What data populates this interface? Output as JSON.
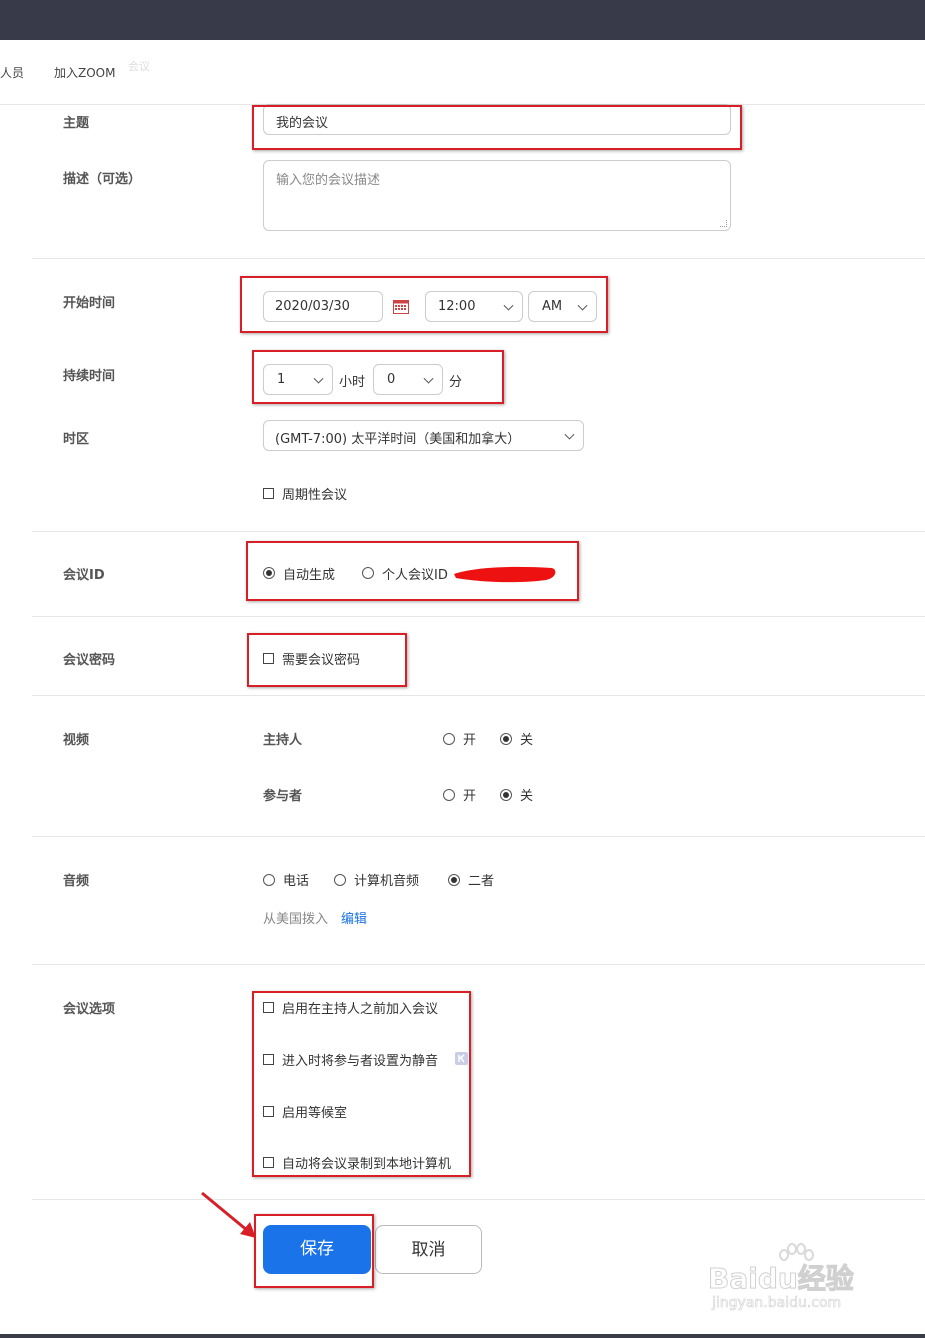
{
  "nav": {
    "item1": "人员",
    "item2": "加入ZOOM",
    "faint": "会议"
  },
  "labels": {
    "topic": "主题",
    "description": "描述（可选）",
    "start_time": "开始时间",
    "duration": "持续时间",
    "timezone": "时区",
    "meeting_id": "会议ID",
    "password": "会议密码",
    "video": "视频",
    "audio": "音频",
    "options": "会议选项"
  },
  "topic": {
    "value": "我的会议"
  },
  "description": {
    "placeholder": "输入您的会议描述"
  },
  "start": {
    "date": "2020/03/30",
    "time": "12:00",
    "ampm": "AM"
  },
  "duration": {
    "hours": "1",
    "hours_unit": "小时",
    "minutes": "0",
    "minutes_unit": "分"
  },
  "timezone": {
    "value": "(GMT-7:00) 太平洋时间（美国和加拿大）"
  },
  "recurring": {
    "label": "周期性会议",
    "checked": false
  },
  "meeting_id": {
    "auto_label": "自动生成",
    "personal_label": "个人会议ID",
    "selected": "auto"
  },
  "password": {
    "label": "需要会议密码",
    "checked": false
  },
  "video": {
    "host_label": "主持人",
    "participant_label": "参与者",
    "on_label": "开",
    "off_label": "关",
    "host": "off",
    "participant": "off"
  },
  "audio": {
    "phone_label": "电话",
    "computer_label": "计算机音频",
    "both_label": "二者",
    "selected": "both",
    "dial_from": "从美国拨入",
    "edit_link": "编辑"
  },
  "options": [
    {
      "label": "启用在主持人之前加入会议",
      "checked": false
    },
    {
      "label": "进入时将参与者设置为静音",
      "checked": false
    },
    {
      "label": "启用等候室",
      "checked": false
    },
    {
      "label": "自动将会议录制到本地计算机",
      "checked": false
    }
  ],
  "buttons": {
    "save": "保存",
    "cancel": "取消"
  },
  "watermark": {
    "brand": "Baidu经验",
    "url": "jingyan.baidu.com"
  },
  "colors": {
    "primary": "#1a73e8",
    "annotation_red": "#d81e27",
    "topbar": "#383a4a"
  }
}
